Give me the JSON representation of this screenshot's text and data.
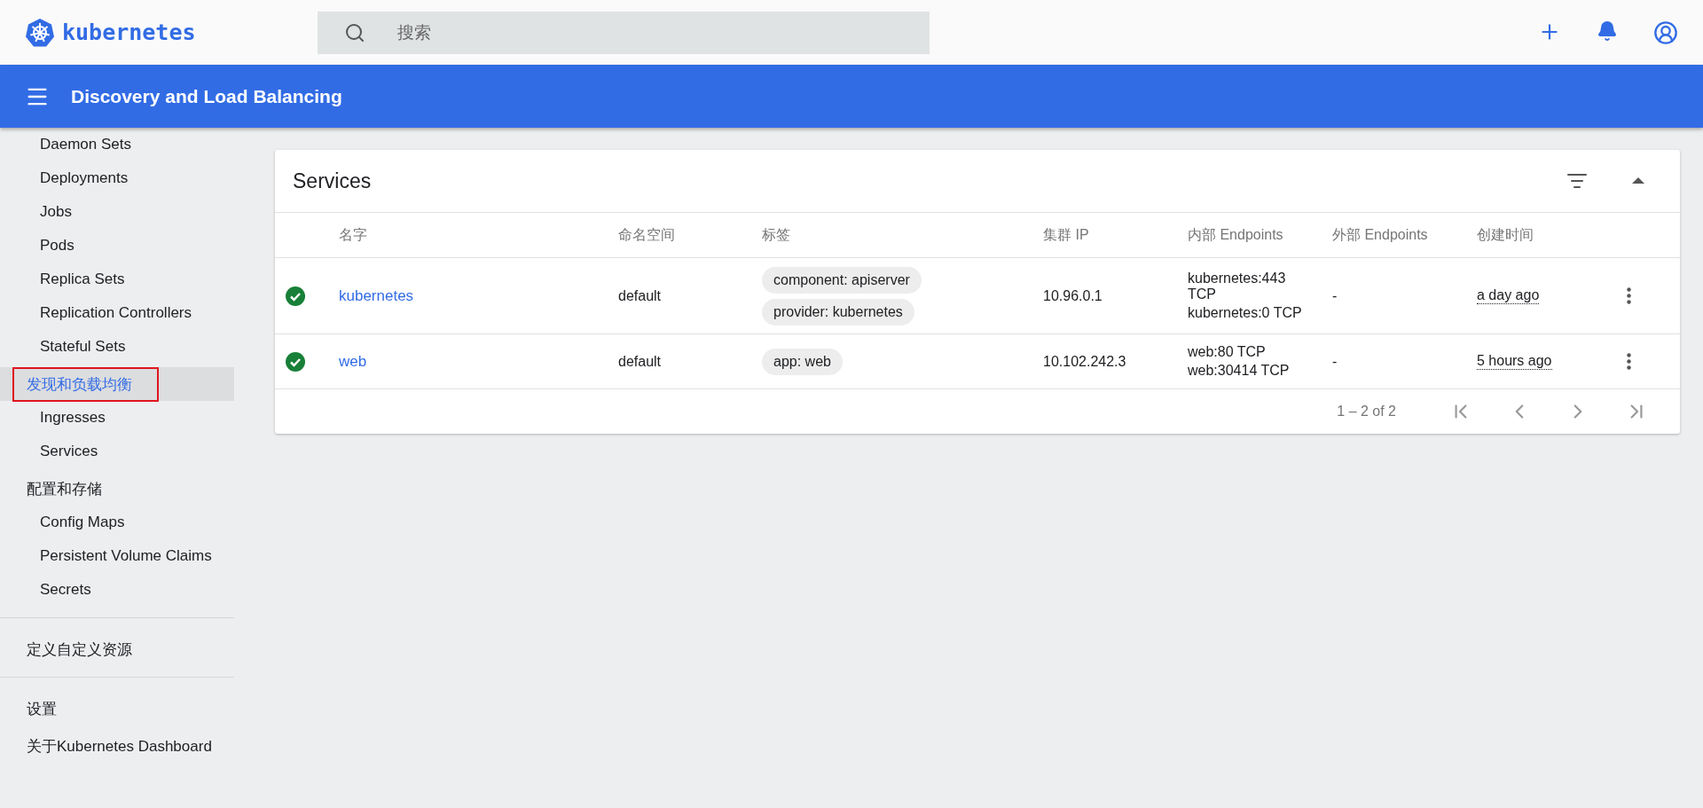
{
  "topbar": {
    "logo_text": "kubernetes",
    "search": {
      "placeholder": "搜索"
    }
  },
  "header": {
    "title": "Discovery and Load Balancing"
  },
  "sidebar": {
    "items": [
      {
        "kind": "sub",
        "label": "Daemon Sets",
        "selected": false
      },
      {
        "kind": "sub",
        "label": "Deployments",
        "selected": false
      },
      {
        "kind": "sub",
        "label": "Jobs",
        "selected": false
      },
      {
        "kind": "sub",
        "label": "Pods",
        "selected": false
      },
      {
        "kind": "sub",
        "label": "Replica Sets",
        "selected": false
      },
      {
        "kind": "sub",
        "label": "Replication Controllers",
        "selected": false
      },
      {
        "kind": "sub",
        "label": "Stateful Sets",
        "selected": false
      },
      {
        "kind": "section",
        "label": "发现和负载均衡",
        "selected": true,
        "outlined": true
      },
      {
        "kind": "sub",
        "label": "Ingresses",
        "selected": false
      },
      {
        "kind": "sub",
        "label": "Services",
        "selected": false
      },
      {
        "kind": "section",
        "label": "配置和存储",
        "selected": false,
        "outlined": false
      },
      {
        "kind": "sub",
        "label": "Config Maps",
        "selected": false
      },
      {
        "kind": "sub",
        "label": "Persistent Volume Claims",
        "selected": false
      },
      {
        "kind": "sub",
        "label": "Secrets",
        "selected": false
      },
      {
        "kind": "divider"
      },
      {
        "kind": "section",
        "label": "定义自定义资源",
        "selected": false,
        "outlined": false
      },
      {
        "kind": "divider"
      },
      {
        "kind": "section",
        "label": "设置",
        "selected": false,
        "outlined": false
      },
      {
        "kind": "section",
        "label": "关于Kubernetes Dashboard",
        "selected": false,
        "outlined": false
      }
    ]
  },
  "card": {
    "title": "Services",
    "table": {
      "columns": [
        "名字",
        "命名空间",
        "标签",
        "集群 IP",
        "内部 Endpoints",
        "外部 Endpoints",
        "创建时间"
      ],
      "rows": [
        {
          "healthy": true,
          "name": "kubernetes",
          "namespace": "default",
          "labels": [
            "component: apiserver",
            "provider: kubernetes"
          ],
          "cluster_ip": "10.96.0.1",
          "internal_endpoints": [
            "kubernetes:443 TCP",
            "kubernetes:0 TCP"
          ],
          "external_endpoints": "-",
          "created": "a day ago"
        },
        {
          "healthy": true,
          "name": "web",
          "namespace": "default",
          "labels": [
            "app: web"
          ],
          "cluster_ip": "10.102.242.3",
          "internal_endpoints": [
            "web:80 TCP",
            "web:30414 TCP"
          ],
          "external_endpoints": "-",
          "created": "5 hours ago"
        }
      ]
    },
    "pagination": {
      "range": "1 – 2 of 2"
    }
  }
}
